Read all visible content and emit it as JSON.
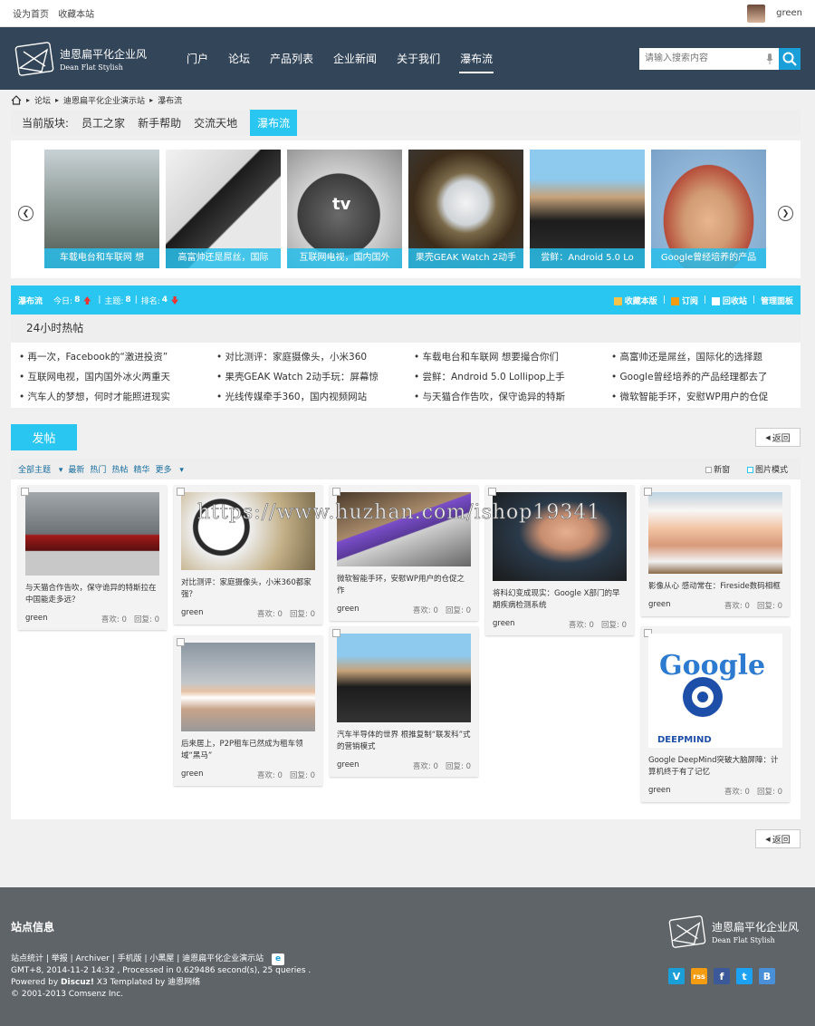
{
  "topbar": {
    "links": [
      "设为首页",
      "收藏本站"
    ],
    "username": "green"
  },
  "header": {
    "logo_cn": "迪恩扁平化企业风",
    "logo_en": "Dean Flat Stylish",
    "nav": [
      "门户",
      "论坛",
      "产品列表",
      "企业新闻",
      "关于我们",
      "瀑布流"
    ],
    "active_nav": "瀑布流",
    "search_placeholder": "请输入搜索内容"
  },
  "breadcrumb": [
    "论坛",
    "迪恩扁平化企业演示站",
    "瀑布流"
  ],
  "board": {
    "label": "当前版块:",
    "items": [
      "员工之家",
      "新手帮助",
      "交流天地",
      "瀑布流"
    ],
    "active": "瀑布流"
  },
  "slider": {
    "captions": [
      "车载电台和车联网 想",
      "高富帅还是屌丝，国际",
      "互联网电视，国内国外",
      "果壳GEAK Watch 2动手",
      "尝鲜：Android 5.0 Lo",
      "Google曾经培养的产品"
    ],
    "tv_text": "tv"
  },
  "stats": {
    "forum": "瀑布流",
    "today_label": "今日:",
    "today": "8",
    "topics_label": "主题:",
    "topics": "8",
    "rank_label": "排名:",
    "rank": "4",
    "actions": [
      "收藏本版",
      "订阅",
      "回收站",
      "管理面板"
    ]
  },
  "hot": {
    "title": "24小时热帖",
    "items": [
      "再一次，Facebook的“激进投资”",
      "对比测评：家庭摄像头，小米360",
      "车载电台和车联网 想要撮合你们",
      "高富帅还是屌丝，国际化的选择题",
      "互联网电视，国内国外冰火两重天",
      "果壳GEAK Watch 2动手玩：屏幕惊",
      "尝鲜：Android 5.0 Lollipop上手",
      "Google曾经培养的产品经理都去了",
      "汽车人的梦想，何时才能照进现实",
      "光线传媒牵手360，国内视频网站",
      "与天猫合作告吹，保守诡异的特斯",
      "微软智能手环，安慰WP用户的仓促"
    ]
  },
  "actions": {
    "post": "发帖",
    "back": "返回"
  },
  "filter": {
    "left": [
      "全部主题",
      "最新",
      "热门",
      "热帖",
      "精华",
      "更多"
    ],
    "new_label": "新窗",
    "image_mode_label": "图片模式"
  },
  "cards": [
    {
      "title": "与天猫合作告吹，保守诡异的特斯拉在中国能走多远？",
      "author": "green",
      "likes": "喜欢: 0",
      "replies": "回复: 0"
    },
    {
      "title": "对比测评：家庭摄像头，小米360都家强？",
      "author": "green",
      "likes": "喜欢: 0",
      "replies": "回复: 0"
    },
    {
      "title": "后来居上，P2P租车已然成为租车领域“黑马”",
      "author": "green",
      "likes": "喜欢: 0",
      "replies": "回复: 0"
    },
    {
      "title": "微软智能手环，安慰WP用户的仓促之作",
      "author": "green",
      "likes": "喜欢: 0",
      "replies": "回复: 0"
    },
    {
      "title": "汽车半导体的世界 根推复制“联发科”式的营销模式",
      "author": "green",
      "likes": "喜欢: 0",
      "replies": "回复: 0"
    },
    {
      "title": "将科幻变成现实：Google X部门的早期疾病检测系统",
      "author": "green",
      "likes": "喜欢: 0",
      "replies": "回复: 0"
    },
    {
      "title": "影像从心 感动常在：Fireside数码相框",
      "author": "green",
      "likes": "喜欢: 0",
      "replies": "回复: 0"
    },
    {
      "title": "Google DeepMind突破大脑屏障：计算机终于有了记忆",
      "author": "green",
      "likes": "喜欢: 0",
      "replies": "回复: 0"
    }
  ],
  "google_img": {
    "word": "Google",
    "label": "DEEPMIND"
  },
  "footer": {
    "title": "站点信息",
    "links": "站点统计 | 举报 | Archiver | 手机版 | 小黑屋 | 迪恩扁平化企业演示站",
    "line1": "GMT+8, 2014-11-2 14:32 , Processed in 0.629486 second(s), 25 queries .",
    "line2_prefix": "Powered by ",
    "line2_brand": "Discuz!",
    "line2_suffix": " X3 Templated by 迪恩网络",
    "line3": "© 2001-2013 Comsenz Inc.",
    "logo_cn": "迪恩扁平化企业风",
    "logo_en": "Dean Flat Stylish",
    "social": [
      "V",
      "rss",
      "f",
      "t",
      "B"
    ],
    "social_colors": [
      "#1a9fd9",
      "#f39c12",
      "#3b5998",
      "#1da1f2",
      "#4a90d9"
    ]
  },
  "watermark": "https://www.huzhan.com/ishop19341"
}
